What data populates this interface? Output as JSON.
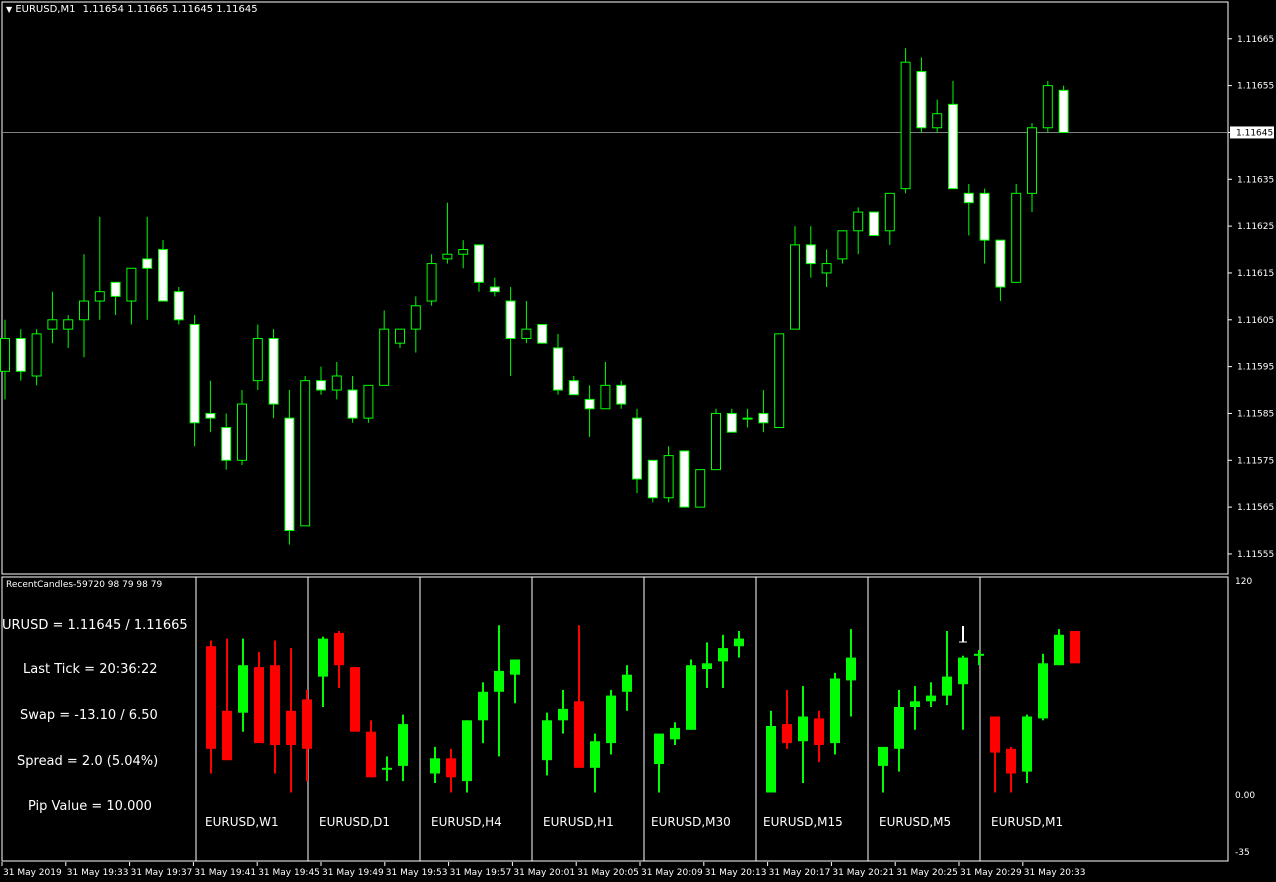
{
  "title_bar": {
    "menu_icon": "triangle-down-icon",
    "symbol": "EURUSD,M1",
    "ohlc": "1.11654 1.11665 1.11645 1.11645"
  },
  "price_axis": {
    "ticks": [
      "1.11665",
      "1.11655",
      "1.11645",
      "1.11635",
      "1.11625",
      "1.11615",
      "1.11605",
      "1.11595",
      "1.11585",
      "1.11575",
      "1.11565",
      "1.11555"
    ],
    "current_price": "1.11645"
  },
  "indicator": {
    "title": "RecentCandles-59720 98 79 98 79",
    "axis_top": "120",
    "axis_mid": "0.00",
    "axis_bottom": "-35",
    "info": {
      "bid_ask": "URUSD = 1.11645 / 1.11665",
      "last_tick": "Last Tick = 20:36:22",
      "swap": "Swap = -13.10 / 6.50",
      "spread": "Spread = 2.0  (5.04%)",
      "pip_value": "Pip Value = 10.000"
    },
    "panels": [
      "EURUSD,W1",
      "EURUSD,D1",
      "EURUSD,H4",
      "EURUSD,H1",
      "EURUSD,M30",
      "EURUSD,M15",
      "EURUSD,M5",
      "EURUSD,M1"
    ]
  },
  "time_axis": [
    "31 May 2019",
    "31 May 19:33",
    "31 May 19:37",
    "31 May 19:41",
    "31 May 19:45",
    "31 May 19:49",
    "31 May 19:53",
    "31 May 19:57",
    "31 May 20:01",
    "31 May 20:05",
    "31 May 20:09",
    "31 May 20:13",
    "31 May 20:17",
    "31 May 20:21",
    "31 May 20:25",
    "31 May 20:29",
    "31 May 20:33"
  ],
  "colors": {
    "background": "#000000",
    "bull_wick": "#00ff00",
    "bear_fill": "#ffffff",
    "bull_fill": "#000000",
    "grid_line": "#808080",
    "panel_bull": "#00ff00",
    "panel_bear": "#ff0000"
  },
  "chart_data": {
    "type": "candlestick",
    "price_min": 1.11552,
    "price_max": 1.11672,
    "candles": [
      {
        "o": 1.11594,
        "h": 1.11605,
        "l": 1.11588,
        "c": 1.11601
      },
      {
        "o": 1.11601,
        "h": 1.11603,
        "l": 1.11592,
        "c": 1.11594
      },
      {
        "o": 1.11593,
        "h": 1.11603,
        "l": 1.11591,
        "c": 1.11602
      },
      {
        "o": 1.11603,
        "h": 1.11611,
        "l": 1.116,
        "c": 1.11605
      },
      {
        "o": 1.11603,
        "h": 1.11606,
        "l": 1.11599,
        "c": 1.11605
      },
      {
        "o": 1.11605,
        "h": 1.11619,
        "l": 1.11597,
        "c": 1.11609
      },
      {
        "o": 1.11609,
        "h": 1.11627,
        "l": 1.11605,
        "c": 1.11611
      },
      {
        "o": 1.11613,
        "h": 1.11612,
        "l": 1.11606,
        "c": 1.1161
      },
      {
        "o": 1.11609,
        "h": 1.11616,
        "l": 1.11604,
        "c": 1.11616
      },
      {
        "o": 1.11618,
        "h": 1.11627,
        "l": 1.11605,
        "c": 1.11616
      },
      {
        "o": 1.1162,
        "h": 1.11622,
        "l": 1.1161,
        "c": 1.11609
      },
      {
        "o": 1.11611,
        "h": 1.11612,
        "l": 1.11604,
        "c": 1.11605
      },
      {
        "o": 1.11604,
        "h": 1.11606,
        "l": 1.11578,
        "c": 1.11583
      },
      {
        "o": 1.11585,
        "h": 1.11592,
        "l": 1.11581,
        "c": 1.11584
      },
      {
        "o": 1.11582,
        "h": 1.11585,
        "l": 1.11573,
        "c": 1.11575
      },
      {
        "o": 1.11575,
        "h": 1.1159,
        "l": 1.11574,
        "c": 1.11587
      },
      {
        "o": 1.11592,
        "h": 1.11604,
        "l": 1.1159,
        "c": 1.11601
      },
      {
        "o": 1.11601,
        "h": 1.11603,
        "l": 1.11584,
        "c": 1.11587
      },
      {
        "o": 1.11584,
        "h": 1.1159,
        "l": 1.11557,
        "c": 1.1156
      },
      {
        "o": 1.11561,
        "h": 1.11593,
        "l": 1.11561,
        "c": 1.11592
      },
      {
        "o": 1.11592,
        "h": 1.11595,
        "l": 1.11589,
        "c": 1.1159
      },
      {
        "o": 1.1159,
        "h": 1.11596,
        "l": 1.11588,
        "c": 1.11593
      },
      {
        "o": 1.1159,
        "h": 1.11593,
        "l": 1.11583,
        "c": 1.11584
      },
      {
        "o": 1.11584,
        "h": 1.1159,
        "l": 1.11583,
        "c": 1.11591
      },
      {
        "o": 1.11591,
        "h": 1.11607,
        "l": 1.11591,
        "c": 1.11603
      },
      {
        "o": 1.116,
        "h": 1.11603,
        "l": 1.11599,
        "c": 1.11603
      },
      {
        "o": 1.11603,
        "h": 1.1161,
        "l": 1.11598,
        "c": 1.11608
      },
      {
        "o": 1.11609,
        "h": 1.11619,
        "l": 1.11608,
        "c": 1.11617
      },
      {
        "o": 1.11618,
        "h": 1.1163,
        "l": 1.11617,
        "c": 1.11619
      },
      {
        "o": 1.11619,
        "h": 1.11622,
        "l": 1.11616,
        "c": 1.1162
      },
      {
        "o": 1.11621,
        "h": 1.11621,
        "l": 1.11611,
        "c": 1.11613
      },
      {
        "o": 1.11612,
        "h": 1.11614,
        "l": 1.1161,
        "c": 1.11611
      },
      {
        "o": 1.11609,
        "h": 1.11612,
        "l": 1.11593,
        "c": 1.11601
      },
      {
        "o": 1.11601,
        "h": 1.11609,
        "l": 1.116,
        "c": 1.11603
      },
      {
        "o": 1.11604,
        "h": 1.11604,
        "l": 1.116,
        "c": 1.116
      },
      {
        "o": 1.11599,
        "h": 1.11602,
        "l": 1.11589,
        "c": 1.1159
      },
      {
        "o": 1.11592,
        "h": 1.11593,
        "l": 1.11589,
        "c": 1.11589
      },
      {
        "o": 1.11588,
        "h": 1.11591,
        "l": 1.1158,
        "c": 1.11586
      },
      {
        "o": 1.11586,
        "h": 1.11596,
        "l": 1.11586,
        "c": 1.11591
      },
      {
        "o": 1.11591,
        "h": 1.11592,
        "l": 1.11586,
        "c": 1.11587
      },
      {
        "o": 1.11584,
        "h": 1.11586,
        "l": 1.11568,
        "c": 1.11571
      },
      {
        "o": 1.11575,
        "h": 1.11575,
        "l": 1.11566,
        "c": 1.11567
      },
      {
        "o": 1.11567,
        "h": 1.11578,
        "l": 1.11566,
        "c": 1.11576
      },
      {
        "o": 1.11577,
        "h": 1.11577,
        "l": 1.11565,
        "c": 1.11565
      },
      {
        "o": 1.11565,
        "h": 1.11573,
        "l": 1.11565,
        "c": 1.11573
      },
      {
        "o": 1.11573,
        "h": 1.11586,
        "l": 1.11573,
        "c": 1.11585
      },
      {
        "o": 1.11585,
        "h": 1.11586,
        "l": 1.11581,
        "c": 1.11581
      },
      {
        "o": 1.11584,
        "h": 1.11586,
        "l": 1.11582,
        "c": 1.11584
      },
      {
        "o": 1.11585,
        "h": 1.1159,
        "l": 1.11581,
        "c": 1.11583
      },
      {
        "o": 1.11582,
        "h": 1.11602,
        "l": 1.11582,
        "c": 1.11602
      },
      {
        "o": 1.11603,
        "h": 1.11625,
        "l": 1.11603,
        "c": 1.11621
      },
      {
        "o": 1.11621,
        "h": 1.11625,
        "l": 1.11614,
        "c": 1.11617
      },
      {
        "o": 1.11615,
        "h": 1.1162,
        "l": 1.11612,
        "c": 1.11617
      },
      {
        "o": 1.11618,
        "h": 1.11624,
        "l": 1.11617,
        "c": 1.11624
      },
      {
        "o": 1.11624,
        "h": 1.11629,
        "l": 1.11619,
        "c": 1.11628
      },
      {
        "o": 1.11628,
        "h": 1.11628,
        "l": 1.11623,
        "c": 1.11623
      },
      {
        "o": 1.11624,
        "h": 1.11632,
        "l": 1.11621,
        "c": 1.11632
      },
      {
        "o": 1.11633,
        "h": 1.11663,
        "l": 1.11632,
        "c": 1.1166
      },
      {
        "o": 1.11658,
        "h": 1.11661,
        "l": 1.11645,
        "c": 1.11646
      },
      {
        "o": 1.11646,
        "h": 1.11652,
        "l": 1.11645,
        "c": 1.11649
      },
      {
        "o": 1.11651,
        "h": 1.11656,
        "l": 1.11633,
        "c": 1.11633
      },
      {
        "o": 1.11632,
        "h": 1.11634,
        "l": 1.11623,
        "c": 1.1163
      },
      {
        "o": 1.11632,
        "h": 1.11633,
        "l": 1.11617,
        "c": 1.11622
      },
      {
        "o": 1.11622,
        "h": 1.11622,
        "l": 1.11609,
        "c": 1.11612
      },
      {
        "o": 1.11613,
        "h": 1.11634,
        "l": 1.11613,
        "c": 1.11632
      },
      {
        "o": 1.11632,
        "h": 1.11647,
        "l": 1.11628,
        "c": 1.11646
      },
      {
        "o": 1.11646,
        "h": 1.11656,
        "l": 1.11645,
        "c": 1.11655
      },
      {
        "o": 1.11654,
        "h": 1.11655,
        "l": 1.11645,
        "c": 1.11645
      }
    ],
    "mini_panels": [
      [
        {
          "o": 0.82,
          "h": 0.85,
          "l": 0.15,
          "c": 0.28
        },
        {
          "o": 0.48,
          "h": 0.86,
          "l": 0.22,
          "c": 0.22
        },
        {
          "o": 0.47,
          "h": 0.86,
          "l": 0.37,
          "c": 0.72
        },
        {
          "o": 0.71,
          "h": 0.79,
          "l": 0.4,
          "c": 0.31
        },
        {
          "o": 0.72,
          "h": 0.85,
          "l": 0.15,
          "c": 0.3
        },
        {
          "o": 0.48,
          "h": 0.81,
          "l": 0.05,
          "c": 0.3
        },
        {
          "o": 0.54,
          "h": 0.59,
          "l": 0.11,
          "c": 0.28
        }
      ],
      [
        {
          "o": 0.66,
          "h": 0.87,
          "l": 0.5,
          "c": 0.86
        },
        {
          "o": 0.89,
          "h": 0.9,
          "l": 0.6,
          "c": 0.72
        },
        {
          "o": 0.71,
          "h": 0.71,
          "l": 0.38,
          "c": 0.37
        },
        {
          "o": 0.37,
          "h": 0.43,
          "l": 0.17,
          "c": 0.13
        },
        {
          "o": 0.18,
          "h": 0.24,
          "l": 0.11,
          "c": 0.18
        },
        {
          "o": 0.19,
          "h": 0.46,
          "l": 0.11,
          "c": 0.41
        }
      ],
      [
        {
          "o": 0.15,
          "h": 0.29,
          "l": 0.1,
          "c": 0.23
        },
        {
          "o": 0.23,
          "h": 0.28,
          "l": 0.05,
          "c": 0.13
        },
        {
          "o": 0.11,
          "h": 0.43,
          "l": 0.05,
          "c": 0.43
        },
        {
          "o": 0.43,
          "h": 0.63,
          "l": 0.31,
          "c": 0.58
        },
        {
          "o": 0.58,
          "h": 0.93,
          "l": 0.24,
          "c": 0.69
        },
        {
          "o": 0.67,
          "h": 0.75,
          "l": 0.52,
          "c": 0.75
        }
      ],
      [
        {
          "o": 0.22,
          "h": 0.47,
          "l": 0.14,
          "c": 0.43
        },
        {
          "o": 0.43,
          "h": 0.59,
          "l": 0.36,
          "c": 0.49
        },
        {
          "o": 0.53,
          "h": 0.93,
          "l": 0.18,
          "c": 0.18
        },
        {
          "o": 0.18,
          "h": 0.36,
          "l": 0.05,
          "c": 0.32
        },
        {
          "o": 0.31,
          "h": 0.59,
          "l": 0.25,
          "c": 0.56
        },
        {
          "o": 0.58,
          "h": 0.72,
          "l": 0.48,
          "c": 0.67
        }
      ],
      [
        {
          "o": 0.2,
          "h": 0.36,
          "l": 0.05,
          "c": 0.36
        },
        {
          "o": 0.33,
          "h": 0.42,
          "l": 0.3,
          "c": 0.39
        },
        {
          "o": 0.38,
          "h": 0.75,
          "l": 0.38,
          "c": 0.72
        },
        {
          "o": 0.7,
          "h": 0.84,
          "l": 0.6,
          "c": 0.73
        },
        {
          "o": 0.74,
          "h": 0.88,
          "l": 0.6,
          "c": 0.81
        },
        {
          "o": 0.82,
          "h": 0.9,
          "l": 0.76,
          "c": 0.86
        }
      ],
      [
        {
          "o": 0.05,
          "h": 0.48,
          "l": 0.05,
          "c": 0.4
        },
        {
          "o": 0.41,
          "h": 0.59,
          "l": 0.28,
          "c": 0.31
        },
        {
          "o": 0.32,
          "h": 0.61,
          "l": 0.1,
          "c": 0.45
        },
        {
          "o": 0.44,
          "h": 0.48,
          "l": 0.21,
          "c": 0.3
        },
        {
          "o": 0.31,
          "h": 0.68,
          "l": 0.25,
          "c": 0.65
        },
        {
          "o": 0.64,
          "h": 0.91,
          "l": 0.45,
          "c": 0.76
        }
      ],
      [
        {
          "o": 0.19,
          "h": 0.29,
          "l": 0.05,
          "c": 0.29
        },
        {
          "o": 0.28,
          "h": 0.59,
          "l": 0.16,
          "c": 0.5
        },
        {
          "o": 0.5,
          "h": 0.61,
          "l": 0.38,
          "c": 0.53
        },
        {
          "o": 0.53,
          "h": 0.63,
          "l": 0.5,
          "c": 0.56
        },
        {
          "o": 0.56,
          "h": 0.9,
          "l": 0.51,
          "c": 0.66
        },
        {
          "o": 0.62,
          "h": 0.77,
          "l": 0.38,
          "c": 0.76
        },
        {
          "o": 0.78,
          "h": 0.8,
          "l": 0.72,
          "c": 0.78
        }
      ],
      [
        {
          "o": 0.45,
          "h": 0.45,
          "l": 0.05,
          "c": 0.26
        },
        {
          "o": 0.28,
          "h": 0.29,
          "l": 0.05,
          "c": 0.15
        },
        {
          "o": 0.16,
          "h": 0.46,
          "l": 0.1,
          "c": 0.45
        },
        {
          "o": 0.44,
          "h": 0.78,
          "l": 0.43,
          "c": 0.73
        },
        {
          "o": 0.72,
          "h": 0.91,
          "l": 0.72,
          "c": 0.88
        },
        {
          "o": 0.9,
          "h": 0.9,
          "l": 0.73,
          "c": 0.73
        }
      ]
    ]
  }
}
